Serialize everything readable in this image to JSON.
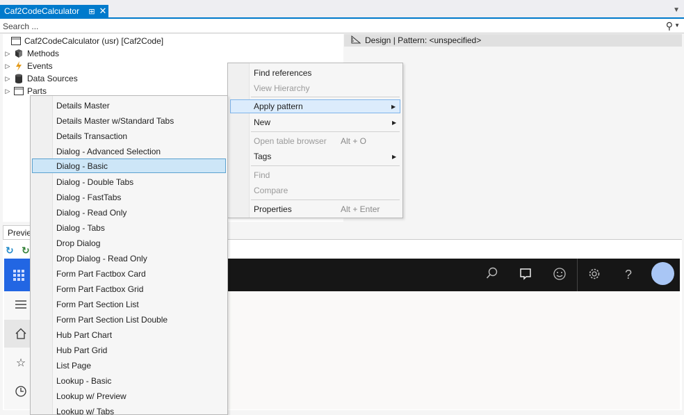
{
  "document_tab": {
    "title": "Caf2CodeCalculator",
    "pin_glyph": "⊞",
    "close_glyph": "✕"
  },
  "search": {
    "placeholder": "Search ..."
  },
  "tree": {
    "root": "Caf2CodeCalculator (usr) [Caf2Code]",
    "nodes": [
      "Methods",
      "Events",
      "Data Sources",
      "Parts"
    ]
  },
  "design_header": {
    "label": "Design | Pattern: <unspecified>"
  },
  "preview": {
    "tab_label": "Previe"
  },
  "context_menu": {
    "items": [
      {
        "label": "Find references",
        "shortcut": "",
        "enabled": true,
        "submenu": false
      },
      {
        "label": "View Hierarchy",
        "shortcut": "",
        "enabled": false,
        "submenu": false
      },
      {
        "label": "Apply pattern",
        "shortcut": "",
        "enabled": true,
        "submenu": true,
        "highlighted": true
      },
      {
        "label": "New",
        "shortcut": "",
        "enabled": true,
        "submenu": true
      },
      {
        "label": "Open table browser",
        "shortcut": "Alt + O",
        "enabled": false,
        "submenu": false
      },
      {
        "label": "Tags",
        "shortcut": "",
        "enabled": true,
        "submenu": true
      },
      {
        "label": "Find",
        "shortcut": "",
        "enabled": false,
        "submenu": false
      },
      {
        "label": "Compare",
        "shortcut": "",
        "enabled": false,
        "submenu": false
      },
      {
        "label": "Properties",
        "shortcut": "Alt + Enter",
        "enabled": true,
        "submenu": false
      }
    ]
  },
  "pattern_menu": {
    "selected": "Dialog - Basic",
    "items": [
      "Details Master",
      "Details Master w/Standard Tabs",
      "Details Transaction",
      "Dialog - Advanced Selection",
      "Dialog - Basic",
      "Dialog - Double Tabs",
      "Dialog - FastTabs",
      "Dialog - Read Only",
      "Dialog - Tabs",
      "Drop Dialog",
      "Drop Dialog - Read Only",
      "Form Part Factbox Card",
      "Form Part Factbox Grid",
      "Form Part Section List",
      "Form Part Section List Double",
      "Hub Part Chart",
      "Hub Part Grid",
      "List Page",
      "Lookup - Basic",
      "Lookup w/ Preview",
      "Lookup w/ Tabs"
    ]
  },
  "colors": {
    "accent": "#007acc",
    "selection": "#cde6f7",
    "app_bar": "#161616",
    "waffle": "#2266e3"
  }
}
